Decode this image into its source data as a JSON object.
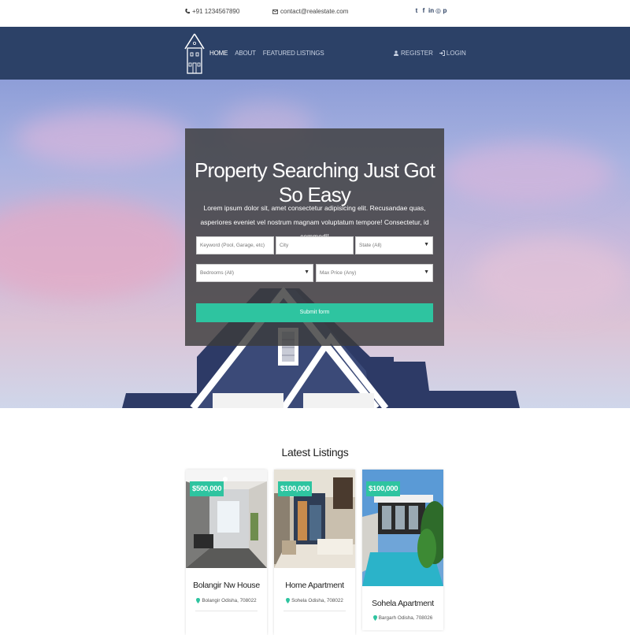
{
  "topbar": {
    "phone": "+91 1234567890",
    "email": "contact@realestate.com",
    "social_icons": [
      "twitter-icon",
      "facebook-icon",
      "linkedin-icon",
      "instagram-icon",
      "pinterest-icon"
    ]
  },
  "nav": {
    "links": [
      {
        "label": "HOME",
        "active": true
      },
      {
        "label": "ABOUT",
        "active": false
      },
      {
        "label": "FEATURED LISTINGS",
        "active": false
      }
    ],
    "register": "REGISTER",
    "login": "LOGIN"
  },
  "search": {
    "title": "Property Searching Just Got So Easy",
    "description": "Lorem ipsum dolor sit, amet consectetur adipisicing elit. Recusandae quas, asperiores eveniet vel nostrum magnam voluptatum tempore! Consectetur, id commodi!",
    "keyword_placeholder": "Keyword (Pool, Garage, etc)",
    "city_placeholder": "City",
    "state_value": "State (All)",
    "bedrooms_value": "Bedrooms (All)",
    "maxprice_value": "Max Price (Any)",
    "submit_label": "Submit form"
  },
  "latest": {
    "title": "Latest Listings",
    "cards": [
      {
        "price": "$500,000",
        "name": "Bolangir Nw House",
        "location": "Bolangir Odisha, 708022"
      },
      {
        "price": "$100,000",
        "name": "Home Apartment",
        "location": "Sohela Odisha, 708022"
      },
      {
        "price": "$100,000",
        "name": "Sohela Apartment",
        "location": "Bargarh Odisha, 708026"
      }
    ]
  },
  "colors": {
    "navbar": "#2c4167",
    "accent": "#2ec4a0",
    "panel": "#3c3c3c"
  }
}
